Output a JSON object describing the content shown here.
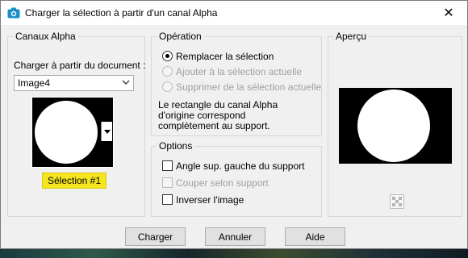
{
  "window": {
    "title": "Charger la sélection à partir d'un canal Alpha",
    "close_glyph": "✕",
    "title_icon": "camera-icon"
  },
  "channels_panel": {
    "legend": "Canaux Alpha",
    "load_label": "Charger à partir du document :",
    "document_value": "Image4",
    "selection_badge": "Sélection #1"
  },
  "operation_panel": {
    "legend": "Opération",
    "options": [
      {
        "label": "Remplacer la sélection",
        "checked": true,
        "enabled": true
      },
      {
        "label": "Ajouter à la sélection actuelle",
        "checked": false,
        "enabled": false
      },
      {
        "label": "Supprimer de la sélection actuelle",
        "checked": false,
        "enabled": false
      }
    ],
    "description_lines": [
      "Le rectangle du canal Alpha",
      "d'origine correspond",
      "complètement au support."
    ]
  },
  "options_panel": {
    "legend": "Options",
    "checkboxes": [
      {
        "label": "Angle sup. gauche du support",
        "checked": false,
        "enabled": true
      },
      {
        "label": "Couper selon support",
        "checked": false,
        "enabled": false
      },
      {
        "label": "Inverser l'image",
        "checked": false,
        "enabled": true
      }
    ]
  },
  "preview_panel": {
    "legend": "Aperçu"
  },
  "buttons": {
    "load": "Charger",
    "cancel": "Annuler",
    "help": "Aide"
  },
  "colors": {
    "badge_bg": "#f5e51f",
    "title_bar": "#ffffff",
    "dialog_bg": "#f0f0f0"
  }
}
